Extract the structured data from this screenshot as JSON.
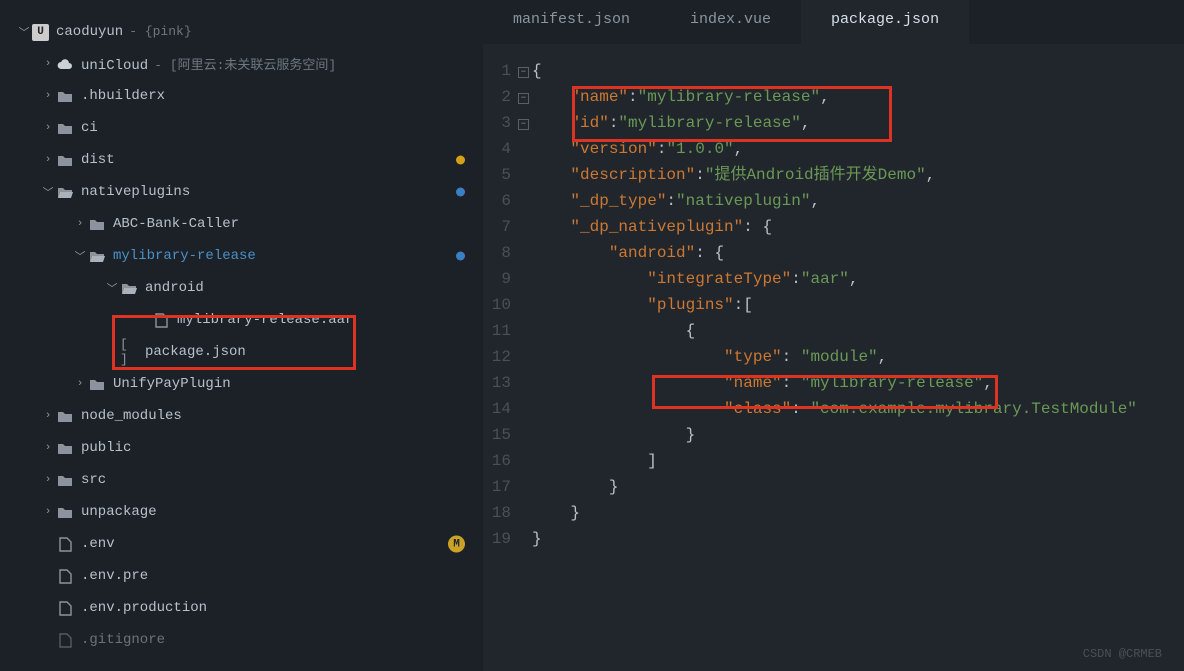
{
  "tabs": {
    "manifest": "manifest.json",
    "index": "index.vue",
    "package": "package.json"
  },
  "tree": {
    "root": "caoduyun",
    "root_hint": "- {pink}",
    "unicloud": "uniCloud",
    "unicloud_hint": "- [阿里云:未关联云服务空间]",
    "hbuilderx": ".hbuilderx",
    "ci": "ci",
    "dist": "dist",
    "nativeplugins": "nativeplugins",
    "abc": "ABC-Bank-Caller",
    "mylib": "mylibrary-release",
    "android": "android",
    "aar": "mylibrary-release.aar",
    "pkg": "package.json",
    "unify": "UnifyPayPlugin",
    "node_modules": "node_modules",
    "public": "public",
    "src": "src",
    "unpackage": "unpackage",
    "env": ".env",
    "envpre": ".env.pre",
    "envprod": ".env.production",
    "gitignore": ".gitignore"
  },
  "code": {
    "l1": "{",
    "l2a": "\"name\"",
    "l2b": ":",
    "l2c": "\"mylibrary-release\"",
    "l2d": ",",
    "l3a": "\"id\"",
    "l3b": ":",
    "l3c": "\"mylibrary-release\"",
    "l3d": ",",
    "l4a": "\"version\"",
    "l4b": ":",
    "l4c": "\"1.0.0\"",
    "l4d": ",",
    "l5a": "\"description\"",
    "l5b": ":",
    "l5c": "\"提供Android插件开发Demo\"",
    "l5d": ",",
    "l6a": "\"_dp_type\"",
    "l6b": ":",
    "l6c": "\"nativeplugin\"",
    "l6d": ",",
    "l7a": "\"_dp_nativeplugin\"",
    "l7b": ": {",
    "l8a": "\"android\"",
    "l8b": ": {",
    "l9a": "\"integrateType\"",
    "l9b": ":",
    "l9c": "\"aar\"",
    "l9d": ",",
    "l10a": "\"plugins\"",
    "l10b": ":[",
    "l11": "{",
    "l12a": "\"type\"",
    "l12b": ": ",
    "l12c": "\"module\"",
    "l12d": ",",
    "l13a": "\"name\"",
    "l13b": ": ",
    "l13c": "\"mylibrary-release\"",
    "l13d": ",",
    "l14a": "\"class\"",
    "l14b": ": ",
    "l14c": "\"com.example.mylibrary.TestModule\"",
    "l15": "}",
    "l16": "]",
    "l17": "}",
    "l18": "}",
    "l19": "}"
  },
  "watermark": "CSDN @CRMEB"
}
